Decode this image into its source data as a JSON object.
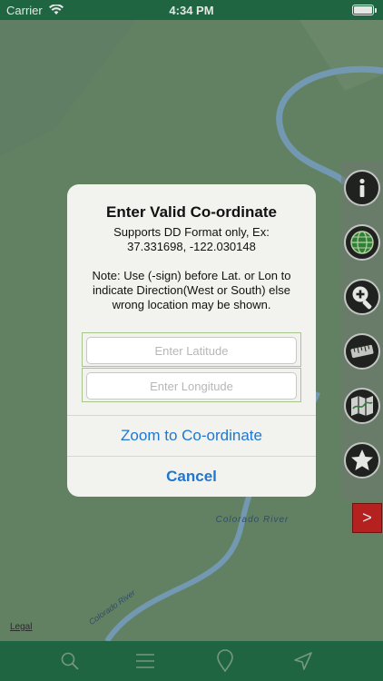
{
  "status_bar": {
    "carrier": "Carrier",
    "time": "4:34 PM",
    "battery_level": 1.0
  },
  "map": {
    "river_label": "Colorado River",
    "river_label_2": "Colorado River",
    "legal_link": "Legal",
    "colors": {
      "land": "#6a8b6c",
      "water": "#7ea6c4"
    }
  },
  "tool_rail": {
    "tools": [
      {
        "name": "info-icon"
      },
      {
        "name": "globe-icon"
      },
      {
        "name": "zoom-in-icon"
      },
      {
        "name": "ruler-icon"
      },
      {
        "name": "map-icon"
      },
      {
        "name": "star-icon"
      }
    ],
    "expand_label": ">",
    "expand_color": "#c81e1e"
  },
  "dialog": {
    "title": "Enter Valid Co-ordinate",
    "message_line1": "Supports DD Format only, Ex:",
    "message_line2": "37.331698, -122.030148",
    "message_note": "Note: Use (-sign) before Lat. or Lon to indicate Direction(West or South) else wrong location may be shown.",
    "latitude_placeholder": "Enter Latitude",
    "latitude_value": "",
    "longitude_placeholder": "Enter Longitude",
    "longitude_value": "",
    "zoom_button": "Zoom to Co-ordinate",
    "cancel_button": "Cancel",
    "accent_color": "#1f77d0"
  },
  "tab_bar": {
    "tabs": [
      {
        "name": "search-icon"
      },
      {
        "name": "menu-icon"
      },
      {
        "name": "location-pin-icon"
      },
      {
        "name": "navigation-arrow-icon"
      }
    ],
    "color": "#1e6b45"
  }
}
